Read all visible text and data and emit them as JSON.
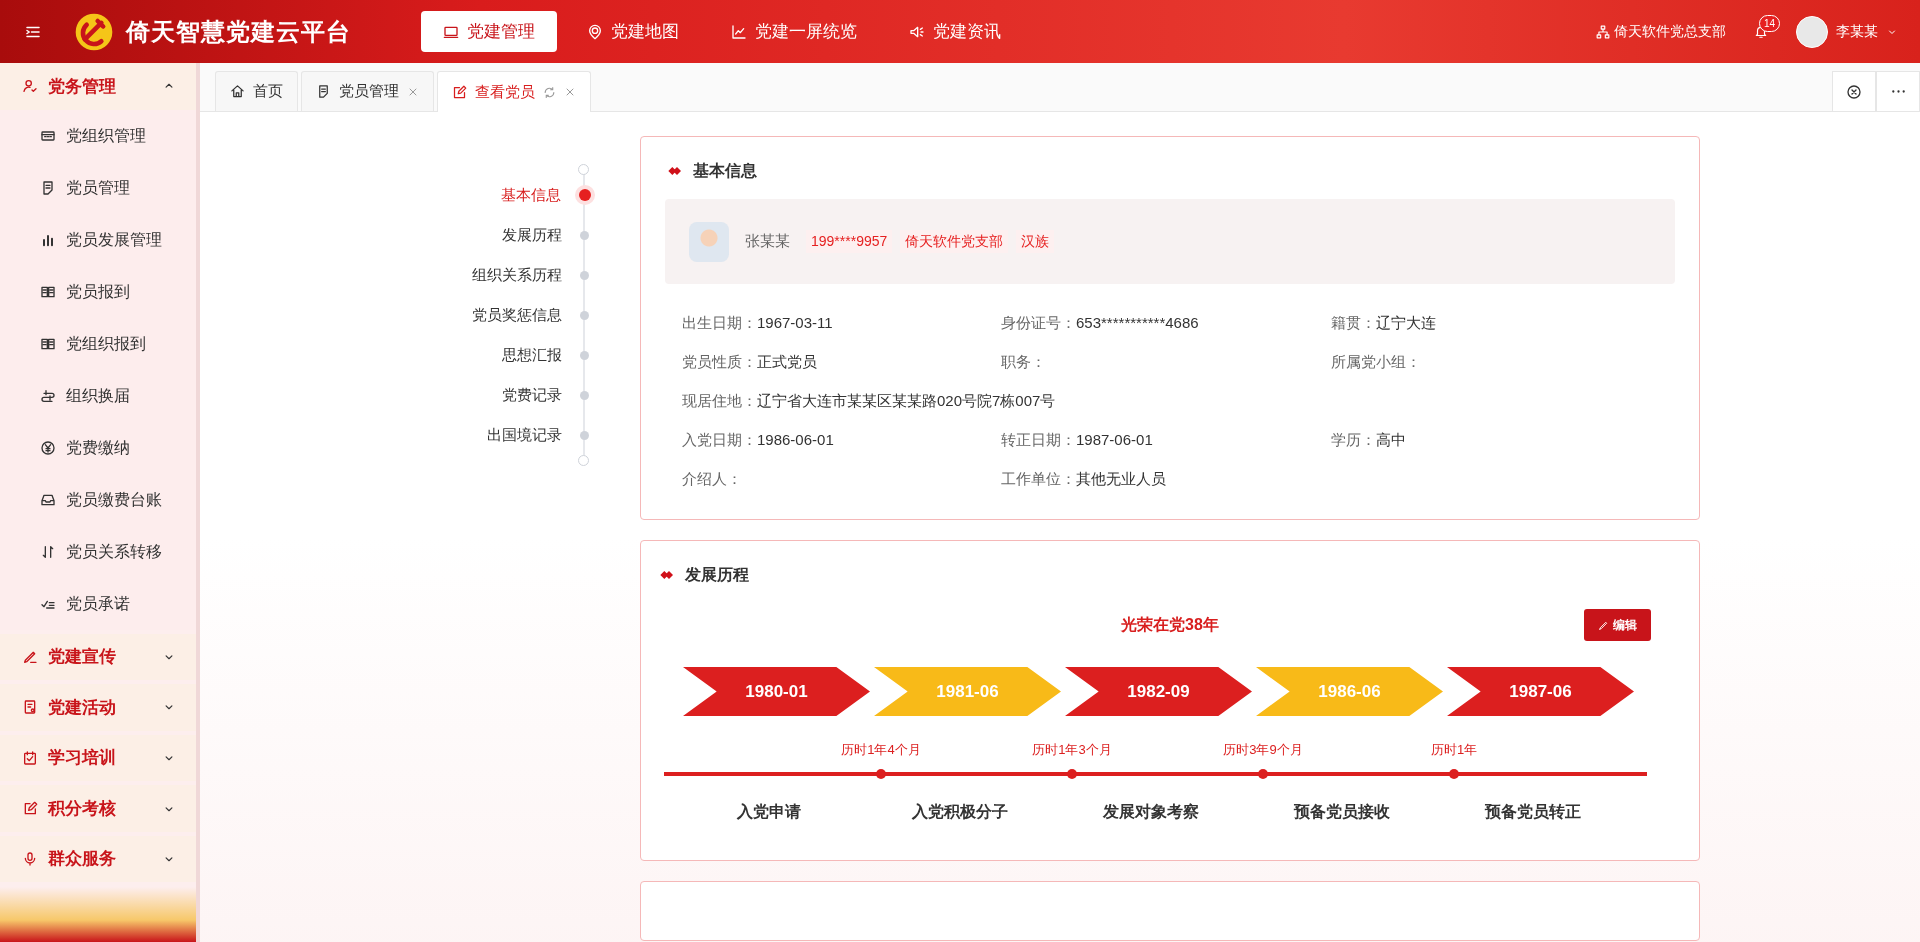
{
  "header": {
    "title": "倚天智慧党建云平台",
    "nav": [
      {
        "label": "党建管理",
        "selected": true
      },
      {
        "label": "党建地图",
        "selected": false
      },
      {
        "label": "党建一屏统览",
        "selected": false
      },
      {
        "label": "党建资讯",
        "selected": false
      }
    ],
    "org": "倚天软件党总支部",
    "notifications": "14",
    "user": "李某某"
  },
  "sidebar": {
    "groups": [
      {
        "label": "党务管理",
        "expanded": true,
        "items": [
          "党组织管理",
          "党员管理",
          "党员发展管理",
          "党员报到",
          "党组织报到",
          "组织换届",
          "党费缴纳",
          "党员缴费台账",
          "党员关系转移",
          "党员承诺"
        ]
      },
      {
        "label": "党建宣传",
        "expanded": false
      },
      {
        "label": "党建活动",
        "expanded": false
      },
      {
        "label": "学习培训",
        "expanded": false
      },
      {
        "label": "积分考核",
        "expanded": false
      },
      {
        "label": "群众服务",
        "expanded": false
      }
    ]
  },
  "tabs": [
    {
      "label": "首页",
      "selected": false,
      "closable": false
    },
    {
      "label": "党员管理",
      "selected": false,
      "closable": true
    },
    {
      "label": "查看党员",
      "selected": true,
      "closable": true
    }
  ],
  "anchors": [
    {
      "label": "基本信息",
      "selected": true
    },
    {
      "label": "发展历程",
      "selected": false
    },
    {
      "label": "组织关系历程",
      "selected": false
    },
    {
      "label": "党员奖惩信息",
      "selected": false
    },
    {
      "label": "思想汇报",
      "selected": false
    },
    {
      "label": "党费记录",
      "selected": false
    },
    {
      "label": "出国境记录",
      "selected": false
    }
  ],
  "basic_info": {
    "title": "基本信息",
    "name": "张某某",
    "tags": [
      "199****9957",
      "倚天软件党支部",
      "汉族"
    ],
    "rows": [
      [
        {
          "label": "出生日期：",
          "value": "1967-03-11"
        },
        {
          "label": "身份证号：",
          "value": "653***********4686"
        },
        {
          "label": "籍贯：",
          "value": "辽宁大连"
        }
      ],
      [
        {
          "label": "党员性质：",
          "value": "正式党员"
        },
        {
          "label": "职务："
        },
        {
          "label": "所属党小组："
        }
      ],
      [
        {
          "label": "现居住地：",
          "value": "辽宁省大连市某某区某某路020号院7栋007号"
        }
      ],
      [
        {
          "label": "入党日期：",
          "value": "1986-06-01"
        },
        {
          "label": "转正日期：",
          "value": "1987-06-01"
        },
        {
          "label": "学历：",
          "value": "高中"
        }
      ],
      [
        {
          "label": "介绍人："
        },
        {
          "label": "工作单位：",
          "value": "其他无业人员"
        }
      ]
    ]
  },
  "development": {
    "title": "发展历程",
    "summary": "光荣在党38年",
    "edit_button": "编辑",
    "steps": [
      {
        "date": "1980-01",
        "color": "#dc1f1f",
        "stage": "入党申请"
      },
      {
        "date": "1981-06",
        "color": "#f8ba18",
        "stage": "入党积极分子"
      },
      {
        "date": "1982-09",
        "color": "#dc1f1f",
        "stage": "发展对象考察"
      },
      {
        "date": "1986-06",
        "color": "#f8ba18",
        "stage": "预备党员接收"
      },
      {
        "date": "1987-06",
        "color": "#dc1f1f",
        "stage": "预备党员转正"
      }
    ],
    "durations": [
      "历时1年4个月",
      "历时1年3个月",
      "历时3年9个月",
      "历时1年"
    ]
  }
}
